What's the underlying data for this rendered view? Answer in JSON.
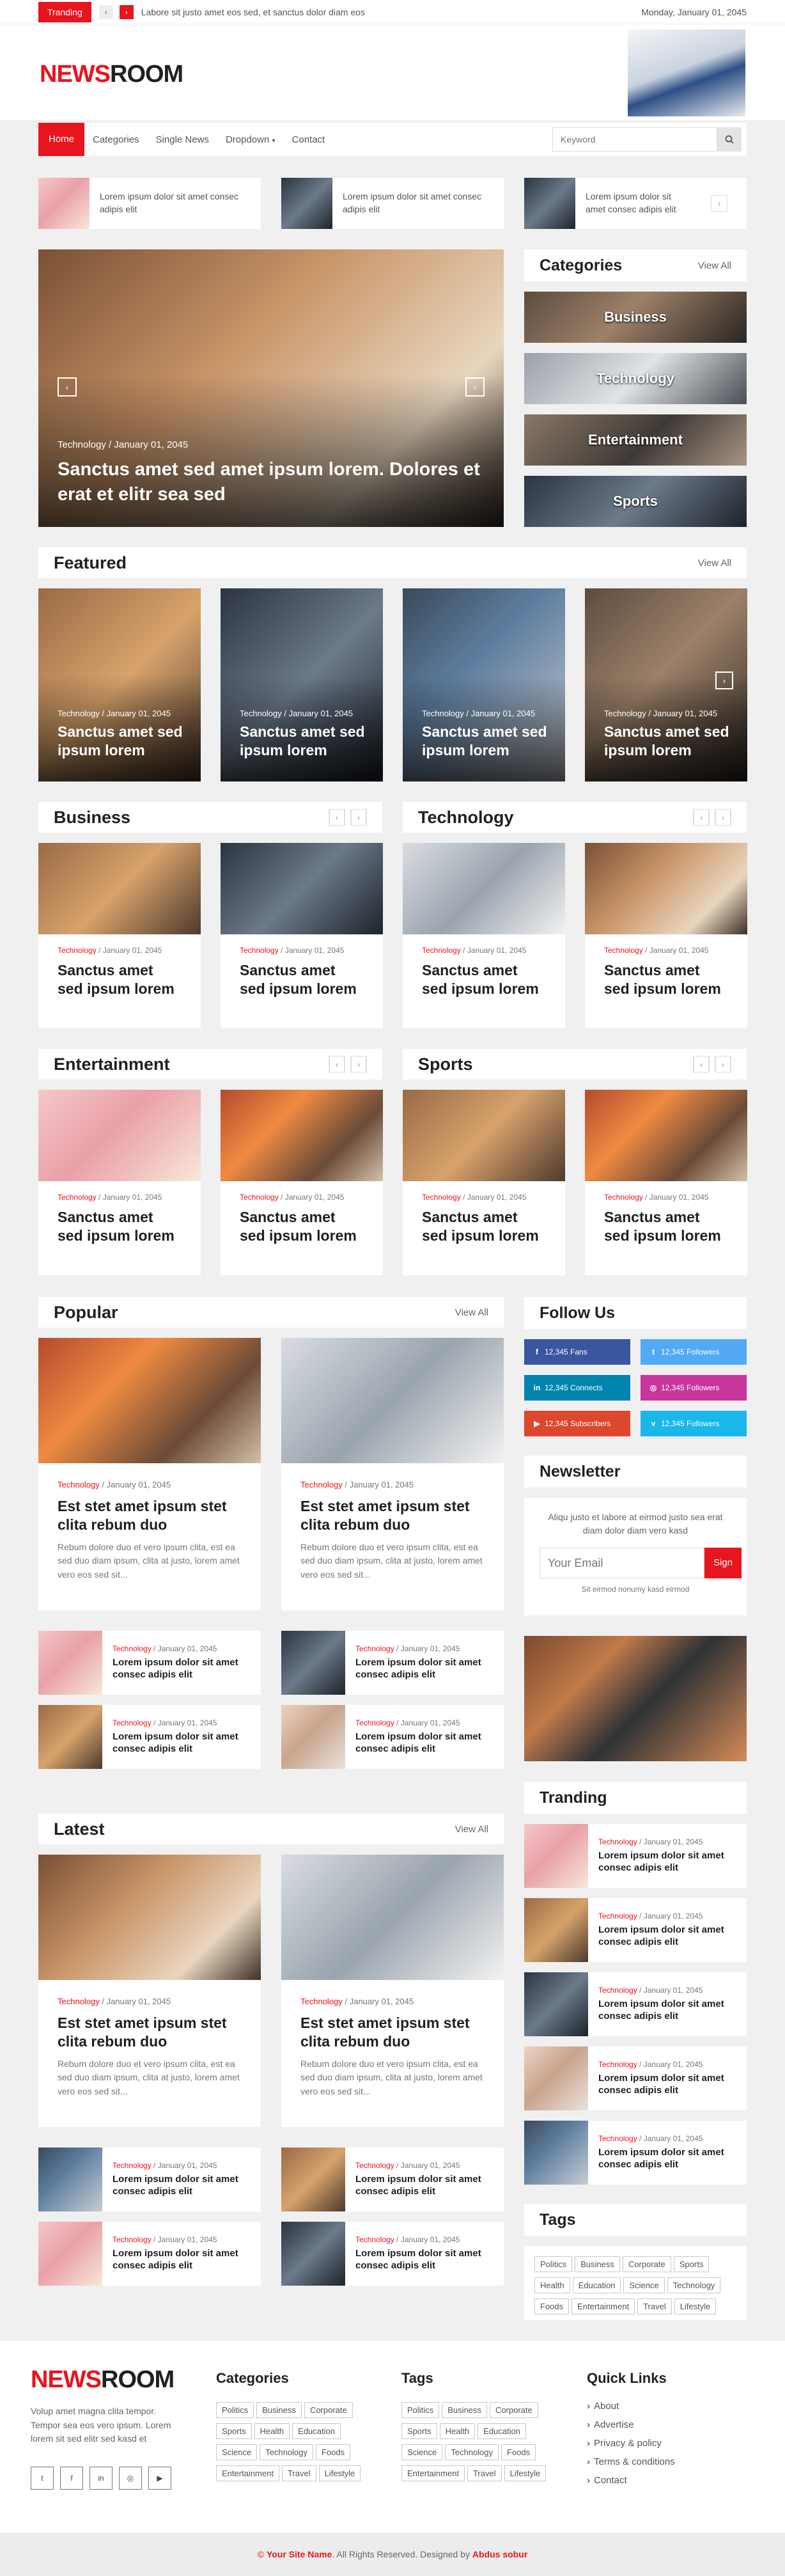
{
  "topbar": {
    "trending_label": "Tranding",
    "prev_icon": "chevron-left-icon",
    "next_icon": "chevron-right-icon",
    "headline": "Labore sit justo amet eos sed, et sanctus dolor diam eos",
    "date": "Monday, January 01, 2045"
  },
  "brand": {
    "part1": "NEWS",
    "part2": "ROOM"
  },
  "nav": {
    "items": [
      "Home",
      "Categories",
      "Single News",
      "Dropdown",
      "Contact"
    ],
    "search_placeholder": "Keyword",
    "search_icon": "search-icon"
  },
  "ticker": [
    "Lorem ipsum dolor sit amet consec adipis elit",
    "Lorem ipsum dolor sit amet consec adipis elit",
    "Lorem ipsum dolor sit amet consec adipis elit"
  ],
  "hero": {
    "category": "Technology",
    "date": "January 01, 2045",
    "title": "Sanctus amet sed amet ipsum lorem. Dolores et erat et elitr sea sed"
  },
  "categories": {
    "title": "Categories",
    "view_all": "View All",
    "items": [
      "Business",
      "Technology",
      "Entertainment",
      "Sports"
    ]
  },
  "featured": {
    "title": "Featured",
    "view_all": "View All",
    "items": [
      {
        "category": "Technology",
        "date": "January 01, 2045",
        "title": "Sanctus amet sed ipsum lorem"
      },
      {
        "category": "Technology",
        "date": "January 01, 2045",
        "title": "Sanctus amet sed ipsum lorem"
      },
      {
        "category": "Technology",
        "date": "January 01, 2045",
        "title": "Sanctus amet sed ipsum lorem"
      },
      {
        "category": "Technology",
        "date": "January 01, 2045",
        "title": "Sanctus amet sed ipsum lorem"
      }
    ]
  },
  "business": {
    "title": "Business",
    "items": [
      {
        "category": "Technology",
        "date": "January 01, 2045",
        "title": "Sanctus amet sed ipsum lorem"
      },
      {
        "category": "Technology",
        "date": "January 01, 2045",
        "title": "Sanctus amet sed ipsum lorem"
      }
    ]
  },
  "technology": {
    "title": "Technology",
    "items": [
      {
        "category": "Technology",
        "date": "January 01, 2045",
        "title": "Sanctus amet sed ipsum lorem"
      },
      {
        "category": "Technology",
        "date": "January 01, 2045",
        "title": "Sanctus amet sed ipsum lorem"
      }
    ]
  },
  "entertainment": {
    "title": "Entertainment",
    "items": [
      {
        "category": "Technology",
        "date": "January 01, 2045",
        "title": "Sanctus amet sed ipsum lorem"
      },
      {
        "category": "Technology",
        "date": "January 01, 2045",
        "title": "Sanctus amet sed ipsum lorem"
      }
    ]
  },
  "sports": {
    "title": "Sports",
    "items": [
      {
        "category": "Technology",
        "date": "January 01, 2045",
        "title": "Sanctus amet sed ipsum lorem"
      },
      {
        "category": "Technology",
        "date": "January 01, 2045",
        "title": "Sanctus amet sed ipsum lorem"
      }
    ]
  },
  "popular": {
    "title": "Popular",
    "view_all": "View All",
    "big": [
      {
        "category": "Technology",
        "date": "January 01, 2045",
        "title": "Est stet amet ipsum stet clita rebum duo",
        "excerpt": "Rebum dolore duo et vero ipsum clita, est ea sed duo diam ipsum, clita at justo, lorem amet vero eos sed sit..."
      },
      {
        "category": "Technology",
        "date": "January 01, 2045",
        "title": "Est stet amet ipsum stet clita rebum duo",
        "excerpt": "Rebum dolore duo et vero ipsum clita, est ea sed duo diam ipsum, clita at justo, lorem amet vero eos sed sit..."
      }
    ],
    "small": [
      {
        "category": "Technology",
        "date": "January 01, 2045",
        "title": "Lorem ipsum dolor sit amet consec adipis elit"
      },
      {
        "category": "Technology",
        "date": "January 01, 2045",
        "title": "Lorem ipsum dolor sit amet consec adipis elit"
      },
      {
        "category": "Technology",
        "date": "January 01, 2045",
        "title": "Lorem ipsum dolor sit amet consec adipis elit"
      },
      {
        "category": "Technology",
        "date": "January 01, 2045",
        "title": "Lorem ipsum dolor sit amet consec adipis elit"
      }
    ]
  },
  "latest": {
    "title": "Latest",
    "view_all": "View All",
    "big": [
      {
        "category": "Technology",
        "date": "January 01, 2045",
        "title": "Est stet amet ipsum stet clita rebum duo",
        "excerpt": "Rebum dolore duo et vero ipsum clita, est ea sed duo diam ipsum, clita at justo, lorem amet vero eos sed sit..."
      },
      {
        "category": "Technology",
        "date": "January 01, 2045",
        "title": "Est stet amet ipsum stet clita rebum duo",
        "excerpt": "Rebum dolore duo et vero ipsum clita, est ea sed duo diam ipsum, clita at justo, lorem amet vero eos sed sit..."
      }
    ],
    "small": [
      {
        "category": "Technology",
        "date": "January 01, 2045",
        "title": "Lorem ipsum dolor sit amet consec adipis elit"
      },
      {
        "category": "Technology",
        "date": "January 01, 2045",
        "title": "Lorem ipsum dolor sit amet consec adipis elit"
      },
      {
        "category": "Technology",
        "date": "January 01, 2045",
        "title": "Lorem ipsum dolor sit amet consec adipis elit"
      },
      {
        "category": "Technology",
        "date": "January 01, 2045",
        "title": "Lorem ipsum dolor sit amet consec adipis elit"
      }
    ]
  },
  "follow": {
    "title": "Follow Us",
    "items": [
      {
        "label": "12,345 Fans",
        "icon": "facebook-icon",
        "color": "#39569e",
        "glyph": "f"
      },
      {
        "label": "12,345 Followers",
        "icon": "twitter-icon",
        "color": "#52aaf4",
        "glyph": "t"
      },
      {
        "label": "12,345 Connects",
        "icon": "linkedin-icon",
        "color": "#0185ae",
        "glyph": "in"
      },
      {
        "label": "12,345 Followers",
        "icon": "instagram-icon",
        "color": "#c8359d",
        "glyph": "◎"
      },
      {
        "label": "12,345 Subscribers",
        "icon": "youtube-icon",
        "color": "#dc472e",
        "glyph": "▶"
      },
      {
        "label": "12,345 Followers",
        "icon": "vimeo-icon",
        "color": "#1ab7ea",
        "glyph": "v"
      }
    ]
  },
  "newsletter": {
    "title": "Newsletter",
    "text": "Aliqu justo et labore at eirmod justo sea erat diam dolor diam vero kasd",
    "placeholder": "Your Email",
    "button": "Sign Up",
    "note": "Sit eirmod nonumy kasd eirmod"
  },
  "trending": {
    "title": "Tranding",
    "items": [
      {
        "category": "Technology",
        "date": "January 01, 2045",
        "title": "Lorem ipsum dolor sit amet consec adipis elit"
      },
      {
        "category": "Technology",
        "date": "January 01, 2045",
        "title": "Lorem ipsum dolor sit amet consec adipis elit"
      },
      {
        "category": "Technology",
        "date": "January 01, 2045",
        "title": "Lorem ipsum dolor sit amet consec adipis elit"
      },
      {
        "category": "Technology",
        "date": "January 01, 2045",
        "title": "Lorem ipsum dolor sit amet consec adipis elit"
      },
      {
        "category": "Technology",
        "date": "January 01, 2045",
        "title": "Lorem ipsum dolor sit amet consec adipis elit"
      }
    ]
  },
  "tags": {
    "title": "Tags",
    "items": [
      "Politics",
      "Business",
      "Corporate",
      "Sports",
      "Health",
      "Education",
      "Science",
      "Technology",
      "Foods",
      "Entertainment",
      "Travel",
      "Lifestyle"
    ]
  },
  "footer": {
    "about": "Volup amet magna clita tempor. Tempor sea eos vero ipsum. Lorem lorem sit sed elitr sed kasd et",
    "social_icons": [
      "twitter-icon",
      "facebook-icon",
      "linkedin-icon",
      "instagram-icon",
      "youtube-icon"
    ],
    "categories_title": "Categories",
    "categories": [
      "Politics",
      "Business",
      "Corporate",
      "Sports",
      "Health",
      "Education",
      "Science",
      "Technology",
      "Foods",
      "Entertainment",
      "Travel",
      "Lifestyle"
    ],
    "tags_title": "Tags",
    "tags": [
      "Politics",
      "Business",
      "Corporate",
      "Sports",
      "Health",
      "Education",
      "Science",
      "Technology",
      "Foods",
      "Entertainment",
      "Travel",
      "Lifestyle"
    ],
    "links_title": "Quick Links",
    "links": [
      "About",
      "Advertise",
      "Privacy & policy",
      "Terms & conditions",
      "Contact"
    ],
    "copyright_pre": "©",
    "site_name": "Your Site Name",
    "copyright_mid": ". All Rights Reserved. Designed by",
    "designer": "Abdus sobur"
  }
}
